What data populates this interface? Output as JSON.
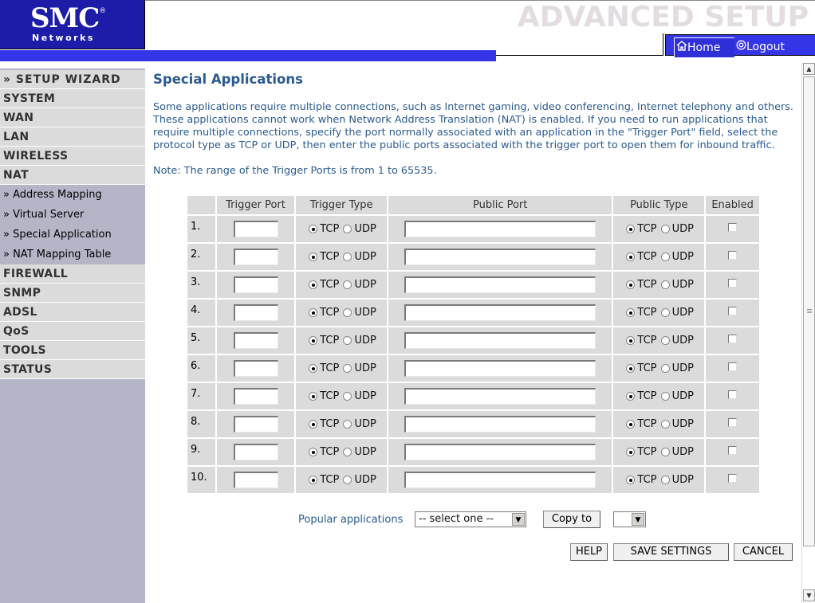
{
  "header": {
    "logo_main": "SMC",
    "logo_reg": "®",
    "logo_sub": "Networks",
    "banner_title": "ADVANCED SETUP",
    "nav_home": "Home",
    "nav_logout": "Logout"
  },
  "sidebar": {
    "items": [
      {
        "label": "» SETUP WIZARD"
      },
      {
        "label": "SYSTEM"
      },
      {
        "label": "WAN"
      },
      {
        "label": "LAN"
      },
      {
        "label": "WIRELESS"
      },
      {
        "label": "NAT"
      },
      {
        "label": "» Address Mapping"
      },
      {
        "label": "» Virtual Server"
      },
      {
        "label": "» Special Application"
      },
      {
        "label": "» NAT Mapping Table"
      },
      {
        "label": "FIREWALL"
      },
      {
        "label": "SNMP"
      },
      {
        "label": "ADSL"
      },
      {
        "label": "QoS"
      },
      {
        "label": "TOOLS"
      },
      {
        "label": "STATUS"
      }
    ]
  },
  "main": {
    "title": "Special Applications",
    "description": "Some applications require multiple connections, such as Internet gaming, video conferencing, Internet telephony and others. These applications cannot work when Network Address Translation (NAT) is enabled. If you need to run applications that require multiple connections, specify the port normally associated with an application in the \"Trigger Port\" field, select the protocol type as TCP or UDP, then enter the public ports associated with the trigger port to open them for inbound traffic.",
    "note": "Note: The range of the Trigger Ports is from 1 to 65535.",
    "table": {
      "headers": [
        "",
        "Trigger Port",
        "Trigger Type",
        "Public Port",
        "Public Type",
        "Enabled"
      ],
      "tcp_label": "TCP",
      "udp_label": "UDP",
      "rows": [
        {
          "num": "1.",
          "trigger_port": "",
          "trigger_type": "TCP",
          "public_port": "",
          "public_type": "TCP",
          "enabled": false
        },
        {
          "num": "2.",
          "trigger_port": "",
          "trigger_type": "TCP",
          "public_port": "",
          "public_type": "TCP",
          "enabled": false
        },
        {
          "num": "3.",
          "trigger_port": "",
          "trigger_type": "TCP",
          "public_port": "",
          "public_type": "TCP",
          "enabled": false
        },
        {
          "num": "4.",
          "trigger_port": "",
          "trigger_type": "TCP",
          "public_port": "",
          "public_type": "TCP",
          "enabled": false
        },
        {
          "num": "5.",
          "trigger_port": "",
          "trigger_type": "TCP",
          "public_port": "",
          "public_type": "TCP",
          "enabled": false
        },
        {
          "num": "6.",
          "trigger_port": "",
          "trigger_type": "TCP",
          "public_port": "",
          "public_type": "TCP",
          "enabled": false
        },
        {
          "num": "7.",
          "trigger_port": "",
          "trigger_type": "TCP",
          "public_port": "",
          "public_type": "TCP",
          "enabled": false
        },
        {
          "num": "8.",
          "trigger_port": "",
          "trigger_type": "TCP",
          "public_port": "",
          "public_type": "TCP",
          "enabled": false
        },
        {
          "num": "9.",
          "trigger_port": "",
          "trigger_type": "TCP",
          "public_port": "",
          "public_type": "TCP",
          "enabled": false
        },
        {
          "num": "10.",
          "trigger_port": "",
          "trigger_type": "TCP",
          "public_port": "",
          "public_type": "TCP",
          "enabled": false
        }
      ]
    },
    "popular": {
      "label": "Popular applications",
      "select_value": "-- select one --",
      "copy_button": "Copy to",
      "copy_target_value": ""
    },
    "buttons": {
      "help": "HELP",
      "save": "SAVE SETTINGS",
      "cancel": "CANCEL"
    }
  },
  "colors": {
    "brand_blue": "#1c1ca8",
    "bar_blue": "#3535e8",
    "title_blue": "#2a5a90",
    "sidebar_bg": "#b5b5c8",
    "sidebar_item": "#dbdbdb",
    "table_bg": "#dbdbdb"
  },
  "icons": {
    "home": "home-icon",
    "logout": "power-icon"
  }
}
